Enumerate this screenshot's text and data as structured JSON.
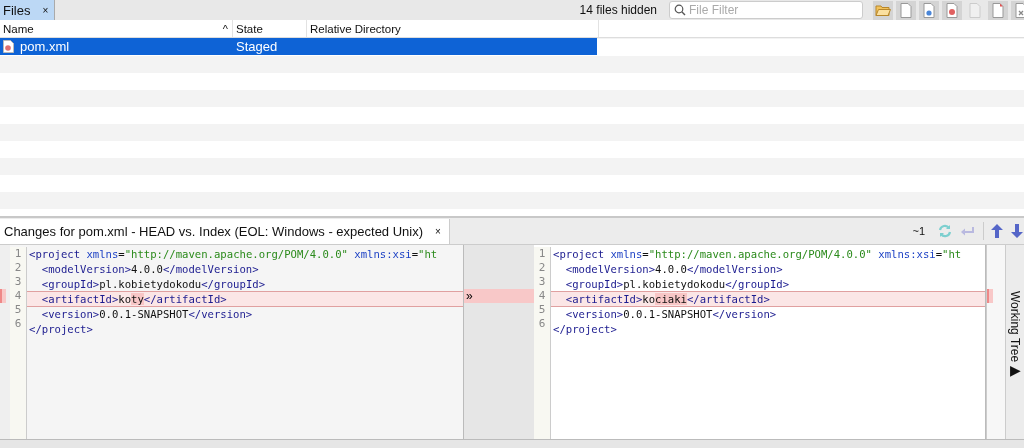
{
  "files_panel": {
    "tab": {
      "label": "Files",
      "close": "×",
      "selected": true
    },
    "hidden_count": "14 files hidden",
    "filter": {
      "placeholder": "File Filter"
    },
    "toolbar": [
      {
        "kind": "folder",
        "pressed": true
      },
      {
        "kind": "doc",
        "pressed": true
      },
      {
        "kind": "gear",
        "pressed": true
      },
      {
        "kind": "record",
        "pressed": true
      },
      {
        "kind": "faded",
        "pressed": false
      },
      {
        "kind": "corner",
        "pressed": true
      },
      {
        "kind": "cross",
        "pressed": true
      }
    ],
    "columns": [
      {
        "label": "Name",
        "sort": "^"
      },
      {
        "label": "State"
      },
      {
        "label": "Relative Directory"
      }
    ],
    "rows": [
      {
        "name": "pom.xml",
        "state": "Staged",
        "selected": true
      }
    ]
  },
  "diff_panel": {
    "tab": {
      "label": "Changes for pom.xml - HEAD vs. Index (EOL: Windows - expected Unix)",
      "close": "×"
    },
    "change_count": "~1",
    "merge_arrow": "»",
    "side_tab": {
      "label": "Working Tree",
      "arrow": "▶"
    },
    "left": [
      {
        "number": "1",
        "changed": false,
        "segments": [
          {
            "kind": "tag",
            "text": "<project"
          },
          {
            "kind": "attr",
            "text": " xmlns"
          },
          {
            "kind": "text",
            "text": "="
          },
          {
            "kind": "string",
            "text": "\"http://maven.apache.org/POM/4.0.0\""
          },
          {
            "kind": "attr",
            "text": " xmlns:xsi"
          },
          {
            "kind": "text",
            "text": "="
          },
          {
            "kind": "string",
            "text": "\"ht"
          }
        ]
      },
      {
        "number": "2",
        "changed": false,
        "segments": [
          {
            "kind": "tag",
            "text": "  <modelVersion>"
          },
          {
            "kind": "text",
            "text": "4.0.0"
          },
          {
            "kind": "tag",
            "text": "</modelVersion>"
          }
        ]
      },
      {
        "number": "3",
        "changed": false,
        "segments": [
          {
            "kind": "tag",
            "text": "  <groupId>"
          },
          {
            "kind": "text",
            "text": "pl.kobietydokodu"
          },
          {
            "kind": "tag",
            "text": "</groupId>"
          }
        ]
      },
      {
        "number": "4",
        "changed": true,
        "segments": [
          {
            "kind": "tag",
            "text": "  <artifactId>"
          },
          {
            "kind": "text",
            "text": "ko"
          },
          {
            "kind": "diff",
            "text": "ty"
          },
          {
            "kind": "tag",
            "text": "</artifactId>"
          }
        ]
      },
      {
        "number": "5",
        "changed": false,
        "segments": [
          {
            "kind": "tag",
            "text": "  <version>"
          },
          {
            "kind": "text",
            "text": "0.0.1-SNAPSHOT"
          },
          {
            "kind": "tag",
            "text": "</version>"
          }
        ]
      },
      {
        "number": "6",
        "changed": false,
        "segments": [
          {
            "kind": "tag",
            "text": "</project>"
          }
        ]
      }
    ],
    "right": [
      {
        "number": "1",
        "changed": false,
        "segments": [
          {
            "kind": "tag",
            "text": "<project"
          },
          {
            "kind": "attr",
            "text": " xmlns"
          },
          {
            "kind": "text",
            "text": "="
          },
          {
            "kind": "string",
            "text": "\"http://maven.apache.org/POM/4.0.0\""
          },
          {
            "kind": "attr",
            "text": " xmlns:xsi"
          },
          {
            "kind": "text",
            "text": "="
          },
          {
            "kind": "string",
            "text": "\"ht"
          }
        ]
      },
      {
        "number": "2",
        "changed": false,
        "segments": [
          {
            "kind": "tag",
            "text": "  <modelVersion>"
          },
          {
            "kind": "text",
            "text": "4.0.0"
          },
          {
            "kind": "tag",
            "text": "</modelVersion>"
          }
        ]
      },
      {
        "number": "3",
        "changed": false,
        "segments": [
          {
            "kind": "tag",
            "text": "  <groupId>"
          },
          {
            "kind": "text",
            "text": "pl.kobietydokodu"
          },
          {
            "kind": "tag",
            "text": "</groupId>"
          }
        ]
      },
      {
        "number": "4",
        "changed": true,
        "segments": [
          {
            "kind": "tag",
            "text": "  <artifactId>"
          },
          {
            "kind": "text",
            "text": "ko"
          },
          {
            "kind": "diff",
            "text": "ciaki"
          },
          {
            "kind": "tag",
            "text": "</artifactId>"
          }
        ]
      },
      {
        "number": "5",
        "changed": false,
        "segments": [
          {
            "kind": "tag",
            "text": "  <version>"
          },
          {
            "kind": "text",
            "text": "0.0.1-SNAPSHOT"
          },
          {
            "kind": "tag",
            "text": "</version>"
          }
        ]
      },
      {
        "number": "6",
        "changed": false,
        "segments": [
          {
            "kind": "tag",
            "text": "</project>"
          }
        ]
      }
    ]
  }
}
